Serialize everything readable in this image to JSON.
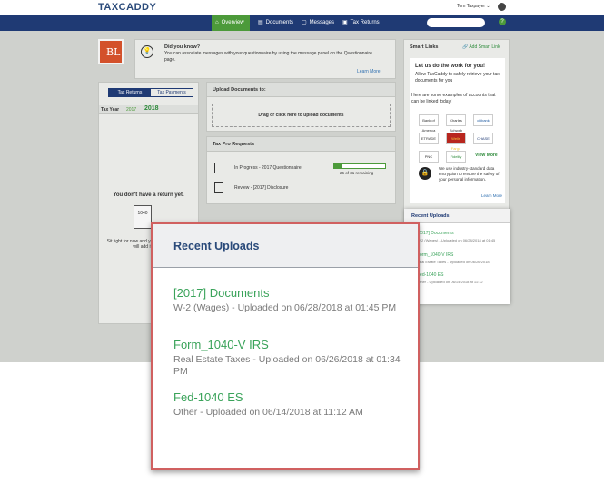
{
  "app": {
    "logo": "TAXCADDY",
    "user_name": "Tom Taxpayer",
    "help_symbol": "?"
  },
  "nav": {
    "items": [
      {
        "label": "Overview",
        "icon": "home-icon",
        "active": true
      },
      {
        "label": "Documents",
        "icon": "document-icon",
        "active": false
      },
      {
        "label": "Messages",
        "icon": "chat-icon",
        "active": false
      },
      {
        "label": "Tax Returns",
        "icon": "returns-icon",
        "active": false
      }
    ]
  },
  "firm_logo": "BL",
  "did_you_know": {
    "title": "Did you know?",
    "text": "You can associate messages with your questionnaire by using the message panel on the Questionnaire page.",
    "learn_more": "Learn More"
  },
  "tax_returns_panel": {
    "tabs": [
      "Tax Returns",
      "Tax Payments"
    ],
    "year_label": "Tax Year",
    "year_prev": "2017",
    "year_current": "2018",
    "empty_title": "You don't have a return yet.",
    "form_label": "1040",
    "empty_text": "Sit tight for now and your tax professional will add it soon."
  },
  "upload_panel": {
    "title": "Upload Documents to:",
    "dropzone_text": "Drag or click here to upload documents"
  },
  "tax_pro_requests": {
    "title": "Tax Pro Requests",
    "items": [
      {
        "label": "In Progress - 2017 Questionnaire",
        "progress_text": "26 of 31 remaining",
        "progress": 0.16
      },
      {
        "label": "Review - [2017] Disclosure"
      }
    ]
  },
  "smart_links": {
    "title": "Smart Links",
    "add_label": "Add Smart Link",
    "box_title": "Let us do the work for you!",
    "box_text": "Allow TaxCaddy to safely retrieve your tax documents for you",
    "examples_text": "Here are some examples of accounts that can be linked today!",
    "banks": [
      "Bank of America",
      "Charles Schwab",
      "citibank",
      "ETRADE",
      "Wells Fargo",
      "CHASE",
      "PNC",
      "Fidelity"
    ],
    "view_more": "View More",
    "security_text": "We use industry-standard data encryption to ensure the safety of your personal information.",
    "learn_more": "Learn More"
  },
  "recent_uploads_small": {
    "title": "Recent Uploads",
    "items": [
      {
        "name": "[2017] Documents",
        "meta": "W-2 (Wages) - Uploaded on 06/28/2018 at 01:45"
      },
      {
        "name": "Form_1040-V IRS",
        "meta": "Real Estate Taxes - Uploaded on 06/26/2018"
      },
      {
        "name": "Fed-1040 ES",
        "meta": "Other - Uploaded on 06/14/2018 at 11:12"
      }
    ]
  },
  "recent_uploads_popup": {
    "title": "Recent Uploads",
    "items": [
      {
        "name": "[2017] Documents",
        "meta": "W-2 (Wages) - Uploaded on 06/28/2018 at 01:45 PM"
      },
      {
        "name": "Form_1040-V IRS",
        "meta": "Real Estate Taxes - Uploaded on 06/26/2018 at 01:34 PM"
      },
      {
        "name": "Fed-1040 ES",
        "meta": "Other - Uploaded on 06/14/2018 at 11:12 AM"
      }
    ]
  }
}
